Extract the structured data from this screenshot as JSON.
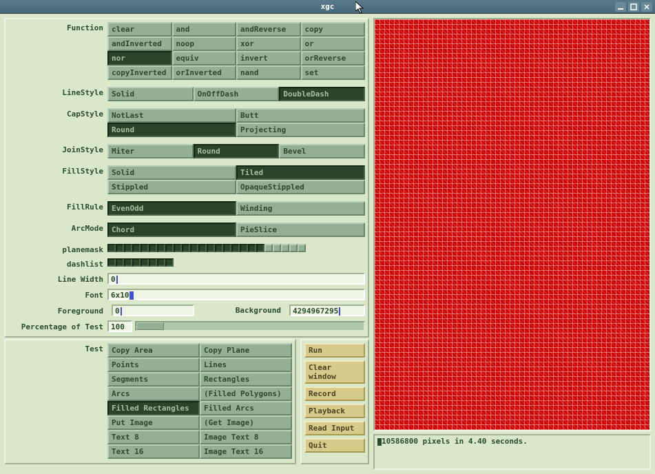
{
  "window": {
    "title": "xgc"
  },
  "labels": {
    "function": "Function",
    "lineStyle": "LineStyle",
    "capStyle": "CapStyle",
    "joinStyle": "JoinStyle",
    "fillStyle": "FillStyle",
    "fillRule": "FillRule",
    "arcMode": "ArcMode",
    "planemask": "planemask",
    "dashlist": "dashlist",
    "lineWidth": "Line Width",
    "font": "Font",
    "foreground": "Foreground",
    "background": "Background",
    "pctTest": "Percentage of Test",
    "test": "Test"
  },
  "function": {
    "selected": "nor",
    "options": [
      "clear",
      "and",
      "andReverse",
      "copy",
      "andInverted",
      "noop",
      "xor",
      "or",
      "nor",
      "equiv",
      "invert",
      "orReverse",
      "copyInverted",
      "orInverted",
      "nand",
      "set"
    ]
  },
  "lineStyle": {
    "selected": "DoubleDash",
    "options": [
      "Solid",
      "OnOffDash",
      "DoubleDash"
    ]
  },
  "capStyle": {
    "selected": "Round",
    "options": [
      "NotLast",
      "Butt",
      "Round",
      "Projecting"
    ]
  },
  "joinStyle": {
    "selected": "Round",
    "options": [
      "Miter",
      "Round",
      "Bevel"
    ]
  },
  "fillStyle": {
    "selected": "Tiled",
    "options": [
      "Solid",
      "Tiled",
      "Stippled",
      "OpaqueStippled"
    ]
  },
  "fillRule": {
    "selected": "EvenOdd",
    "options": [
      "EvenOdd",
      "Winding"
    ]
  },
  "arcMode": {
    "selected": "Chord",
    "options": [
      "Chord",
      "PieSlice"
    ]
  },
  "planemask": [
    1,
    1,
    1,
    1,
    1,
    1,
    1,
    1,
    1,
    1,
    1,
    1,
    1,
    1,
    1,
    1,
    1,
    1,
    1,
    0,
    0,
    0,
    0,
    0
  ],
  "dashlist": [
    1,
    1,
    1,
    1,
    1,
    1,
    1,
    1
  ],
  "lineWidth": "0",
  "font": "6x10",
  "foreground": "0",
  "background": "4294967295",
  "pct": "100",
  "test": {
    "selected": "Filled Rectangles",
    "options": [
      "Copy Area",
      "Copy Plane",
      "Points",
      "Lines",
      "Segments",
      "Rectangles",
      "Arcs",
      "(Filled Polygons)",
      "Filled Rectangles",
      "Filled Arcs",
      "Put Image",
      "(Get Image)",
      "Text 8",
      "Image Text 8",
      "Text 16",
      "Image Text 16"
    ]
  },
  "commands": [
    "Run",
    "Clear window",
    "Record",
    "Playback",
    "Read Input",
    "Quit"
  ],
  "status": "10586800 pixels in 4.40 seconds."
}
